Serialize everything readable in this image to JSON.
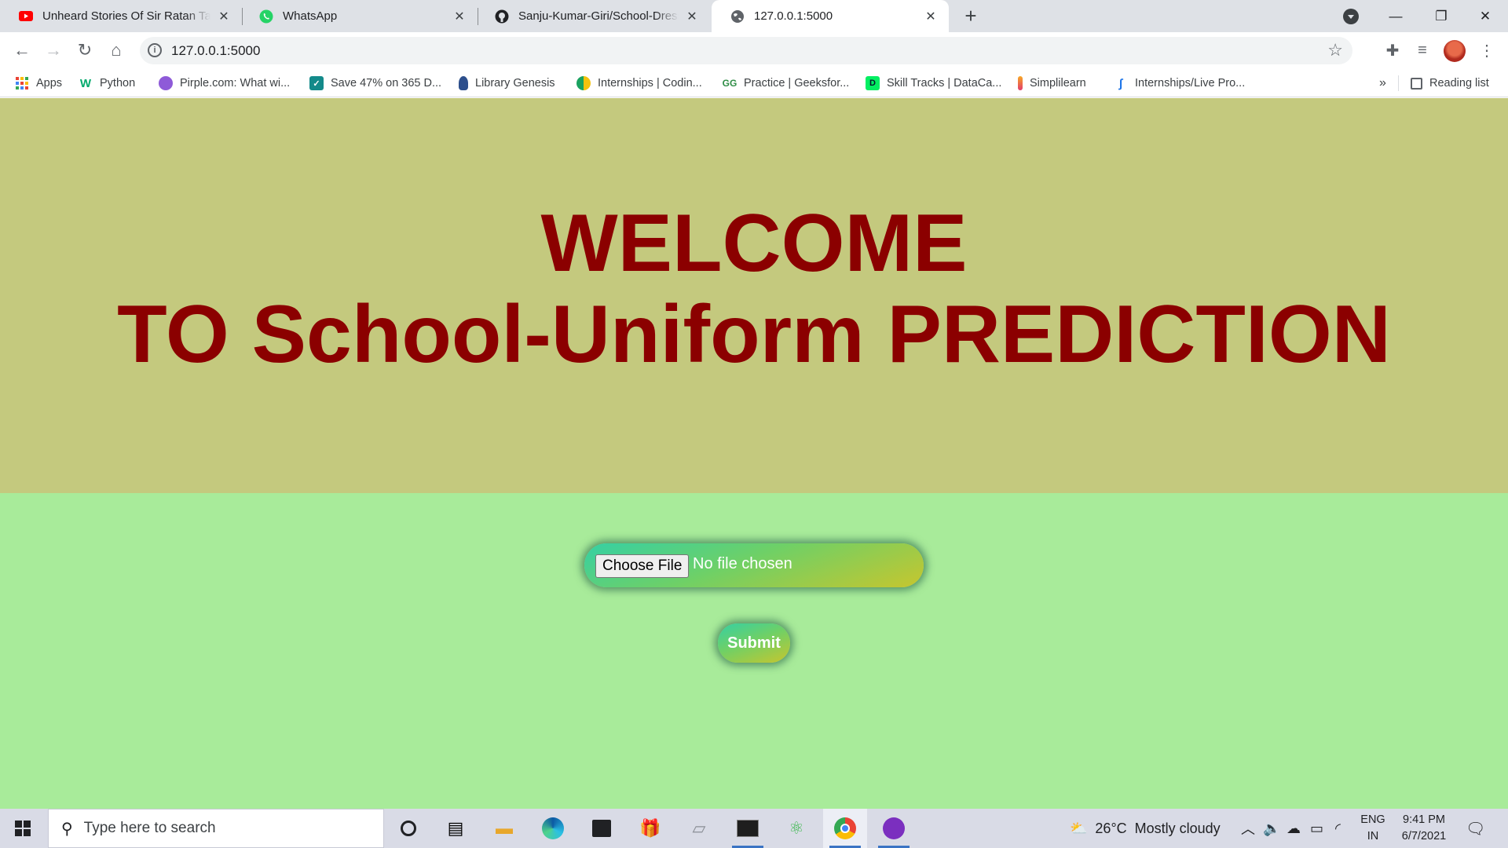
{
  "browser": {
    "tabs": [
      {
        "title": "Unheard Stories Of Sir Ratan Tata",
        "icon": "youtube-icon",
        "active": false
      },
      {
        "title": "WhatsApp",
        "icon": "whatsapp-icon",
        "active": false
      },
      {
        "title": "Sanju-Kumar-Giri/School-Dress-W",
        "icon": "github-icon",
        "active": false
      },
      {
        "title": "127.0.0.1:5000",
        "icon": "globe-icon",
        "active": true
      }
    ],
    "address": {
      "url": "127.0.0.1:5000"
    },
    "bookmarks": [
      {
        "label": "Apps",
        "icon": "apps-grid-icon"
      },
      {
        "label": "Python",
        "icon": "w3schools-icon"
      },
      {
        "label": "Pirple.com: What wi...",
        "icon": "pirple-icon"
      },
      {
        "label": "Save 47% on 365 D...",
        "icon": "checkmark-icon"
      },
      {
        "label": "Library Genesis",
        "icon": "libgen-icon"
      },
      {
        "label": "Internships | Codin...",
        "icon": "internships-icon"
      },
      {
        "label": "Practice | Geeksfor...",
        "icon": "geeksforgeeks-icon"
      },
      {
        "label": "Skill Tracks | DataCa...",
        "icon": "datacamp-icon"
      },
      {
        "label": "Simplilearn",
        "icon": "simplilearn-icon"
      },
      {
        "label": "Internships/Live Pro...",
        "icon": "internships-live-icon"
      }
    ],
    "bookmarks_overflow": "»",
    "reading_list": "Reading list"
  },
  "page": {
    "heading_line1": "WELCOME",
    "heading_line2": "TO School-Uniform PREDICTION",
    "file_input": {
      "button_label": "Choose File",
      "status": "No file chosen"
    },
    "submit_label": "Submit",
    "colors": {
      "hero_bg": "#c4c97e",
      "form_bg": "#a8eb9a",
      "heading": "#8b0000"
    }
  },
  "taskbar": {
    "search_placeholder": "Type here to search",
    "weather": {
      "temp": "26°C",
      "condition": "Mostly cloudy"
    },
    "language": {
      "line1": "ENG",
      "line2": "IN"
    },
    "clock": {
      "time": "9:41 PM",
      "date": "6/7/2021"
    }
  }
}
